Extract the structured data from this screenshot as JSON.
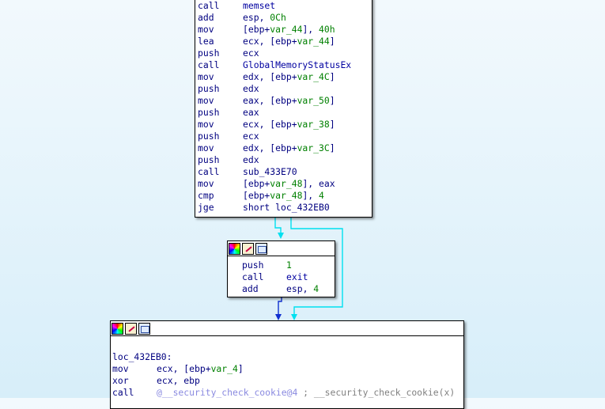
{
  "node_top": {
    "lines": [
      {
        "m": "call",
        "ops": [
          [
            "fn",
            "memset"
          ]
        ]
      },
      {
        "m": "add",
        "ops": [
          [
            "a",
            "esp, "
          ],
          [
            "g",
            "0Ch"
          ]
        ]
      },
      {
        "m": "mov",
        "ops": [
          [
            "a",
            "[ebp+"
          ],
          [
            "g",
            "var_44"
          ],
          [
            "a",
            "], "
          ],
          [
            "g",
            "40h"
          ]
        ]
      },
      {
        "m": "lea",
        "ops": [
          [
            "a",
            "ecx, [ebp+"
          ],
          [
            "g",
            "var_44"
          ],
          [
            "a",
            "]"
          ]
        ]
      },
      {
        "m": "push",
        "ops": [
          [
            "a",
            "ecx"
          ]
        ]
      },
      {
        "m": "call",
        "ops": [
          [
            "fn",
            "GlobalMemoryStatusEx"
          ]
        ]
      },
      {
        "m": "mov",
        "ops": [
          [
            "a",
            "edx, [ebp+"
          ],
          [
            "g",
            "var_4C"
          ],
          [
            "a",
            "]"
          ]
        ]
      },
      {
        "m": "push",
        "ops": [
          [
            "a",
            "edx"
          ]
        ]
      },
      {
        "m": "mov",
        "ops": [
          [
            "a",
            "eax, [ebp+"
          ],
          [
            "g",
            "var_50"
          ],
          [
            "a",
            "]"
          ]
        ]
      },
      {
        "m": "push",
        "ops": [
          [
            "a",
            "eax"
          ]
        ]
      },
      {
        "m": "mov",
        "ops": [
          [
            "a",
            "ecx, [ebp+"
          ],
          [
            "g",
            "var_38"
          ],
          [
            "a",
            "]"
          ]
        ]
      },
      {
        "m": "push",
        "ops": [
          [
            "a",
            "ecx"
          ]
        ]
      },
      {
        "m": "mov",
        "ops": [
          [
            "a",
            "edx, [ebp+"
          ],
          [
            "g",
            "var_3C"
          ],
          [
            "a",
            "]"
          ]
        ]
      },
      {
        "m": "push",
        "ops": [
          [
            "a",
            "edx"
          ]
        ]
      },
      {
        "m": "call",
        "ops": [
          [
            "a",
            "sub_433E70"
          ]
        ]
      },
      {
        "m": "mov",
        "ops": [
          [
            "a",
            "[ebp+"
          ],
          [
            "g",
            "var_48"
          ],
          [
            "a",
            "], eax"
          ]
        ]
      },
      {
        "m": "cmp",
        "ops": [
          [
            "a",
            "[ebp+"
          ],
          [
            "g",
            "var_48"
          ],
          [
            "a",
            "], "
          ],
          [
            "g",
            "4"
          ]
        ]
      },
      {
        "m": "jge",
        "ops": [
          [
            "a",
            "short loc_432EB0"
          ]
        ]
      }
    ]
  },
  "node_mid": {
    "lines": [
      {
        "m": "push",
        "ops": [
          [
            "g",
            "1"
          ]
        ]
      },
      {
        "m": "call",
        "ops": [
          [
            "fn",
            "exit"
          ]
        ]
      },
      {
        "m": "add",
        "ops": [
          [
            "a",
            "esp, "
          ],
          [
            "g",
            "4"
          ]
        ]
      }
    ]
  },
  "node_bottom": {
    "label": "loc_432EB0:",
    "lines": [
      {
        "m": "mov",
        "ops": [
          [
            "a",
            "ecx, [ebp+"
          ],
          [
            "g",
            "var_4"
          ],
          [
            "a",
            "]"
          ]
        ]
      },
      {
        "m": "xor",
        "ops": [
          [
            "a",
            "ecx, ebp"
          ]
        ]
      },
      {
        "m": "call",
        "ops": [
          [
            "sec",
            "@__security_check_cookie@4"
          ],
          [
            "cm",
            " ; __security_check_cookie(x)"
          ]
        ]
      }
    ]
  },
  "colors": {
    "edge_false": "#00e0f0",
    "edge_true": "#1030d0"
  },
  "icons": [
    "color-palette-icon",
    "rename-pencil-icon",
    "graph-view-icon"
  ]
}
